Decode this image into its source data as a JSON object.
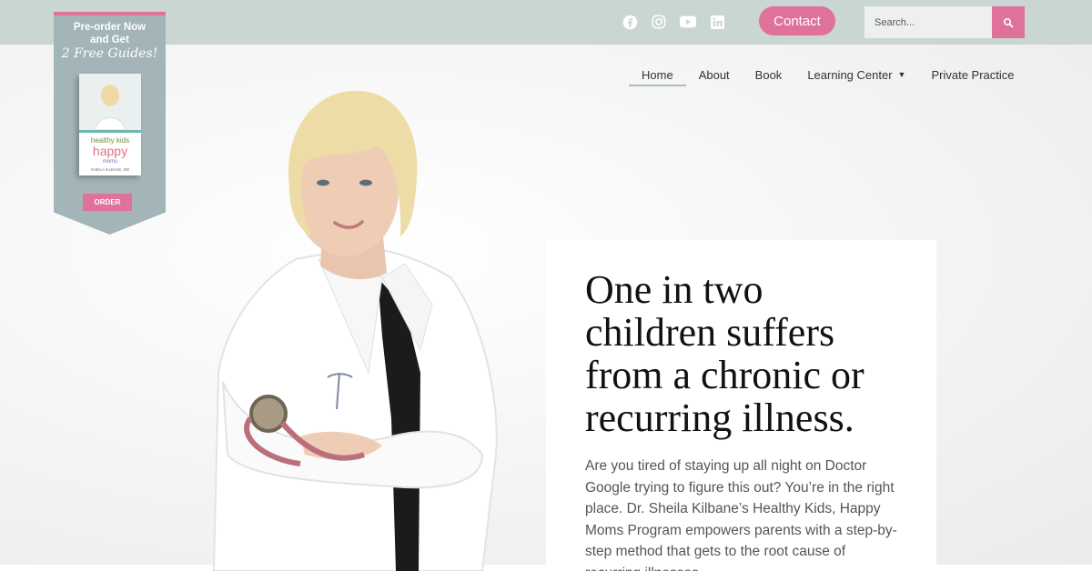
{
  "header": {
    "social": [
      {
        "name": "facebook-icon"
      },
      {
        "name": "instagram-icon"
      },
      {
        "name": "youtube-icon"
      },
      {
        "name": "linkedin-icon"
      }
    ],
    "contact_label": "Contact",
    "search": {
      "placeholder": "Search..."
    }
  },
  "nav": {
    "items": [
      {
        "label": "Home",
        "active": true
      },
      {
        "label": "About"
      },
      {
        "label": "Book"
      },
      {
        "label": "Learning Center",
        "has_dropdown": true
      },
      {
        "label": "Private Practice"
      }
    ]
  },
  "promo": {
    "line1": "Pre-order Now",
    "line2": "and Get",
    "line3": "2 Free Guides!",
    "book": {
      "title_top": "healthy kids",
      "title_mid": "happy",
      "title_bottom": "moms",
      "author": "SHEILA KILBANE, MD"
    },
    "order_label": "ORDER"
  },
  "hero": {
    "headline": "One in two children suffers from a chronic or recurring illness.",
    "body": "Are you tired of staying up all night on Doctor Google trying to figure this out? You’re in the right place. Dr. Sheila Kilbane’s Healthy Kids, Happy Moms Program empowers parents with a step-by-step method that gets to the root cause of recurring illnesses."
  },
  "colors": {
    "topbar": "#c9d6d1",
    "accent_pink": "#e0719b",
    "banner_blue": "#a3b5b9"
  }
}
